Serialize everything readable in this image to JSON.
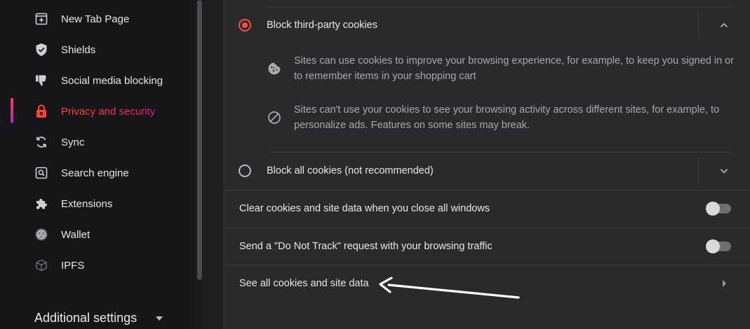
{
  "sidebar": {
    "items": [
      {
        "label": "New Tab Page",
        "icon": "new-tab-icon"
      },
      {
        "label": "Shields",
        "icon": "shield-icon"
      },
      {
        "label": "Social media blocking",
        "icon": "thumbs-down-icon"
      },
      {
        "label": "Privacy and security",
        "icon": "lock-icon",
        "active": true
      },
      {
        "label": "Sync",
        "icon": "sync-icon"
      },
      {
        "label": "Search engine",
        "icon": "search-engine-icon"
      },
      {
        "label": "Extensions",
        "icon": "puzzle-icon"
      },
      {
        "label": "Wallet",
        "icon": "wallet-icon"
      },
      {
        "label": "IPFS",
        "icon": "cube-icon"
      }
    ],
    "additional_settings": "Additional settings"
  },
  "cookies": {
    "block_third_party": {
      "label": "Block third-party cookies",
      "selected": true,
      "expanded": true,
      "details": [
        {
          "icon": "cookie-icon",
          "text": "Sites can use cookies to improve your browsing experience, for example, to keep you signed in or to remember items in your shopping cart"
        },
        {
          "icon": "block-icon",
          "text": "Sites can't use your cookies to see your browsing activity across different sites, for example, to personalize ads. Features on some sites may break."
        }
      ]
    },
    "block_all": {
      "label": "Block all cookies (not recommended)",
      "selected": false,
      "expanded": false
    }
  },
  "settings": {
    "clear_on_close": {
      "label": "Clear cookies and site data when you close all windows",
      "enabled": false
    },
    "do_not_track": {
      "label": "Send a \"Do Not Track\" request with your browsing traffic",
      "enabled": false
    },
    "see_all": {
      "label": "See all cookies and site data"
    }
  },
  "colors": {
    "accent": "#ff4a40",
    "active_gradient_start": "#ff4a3f",
    "active_gradient_end": "#e0197a"
  }
}
